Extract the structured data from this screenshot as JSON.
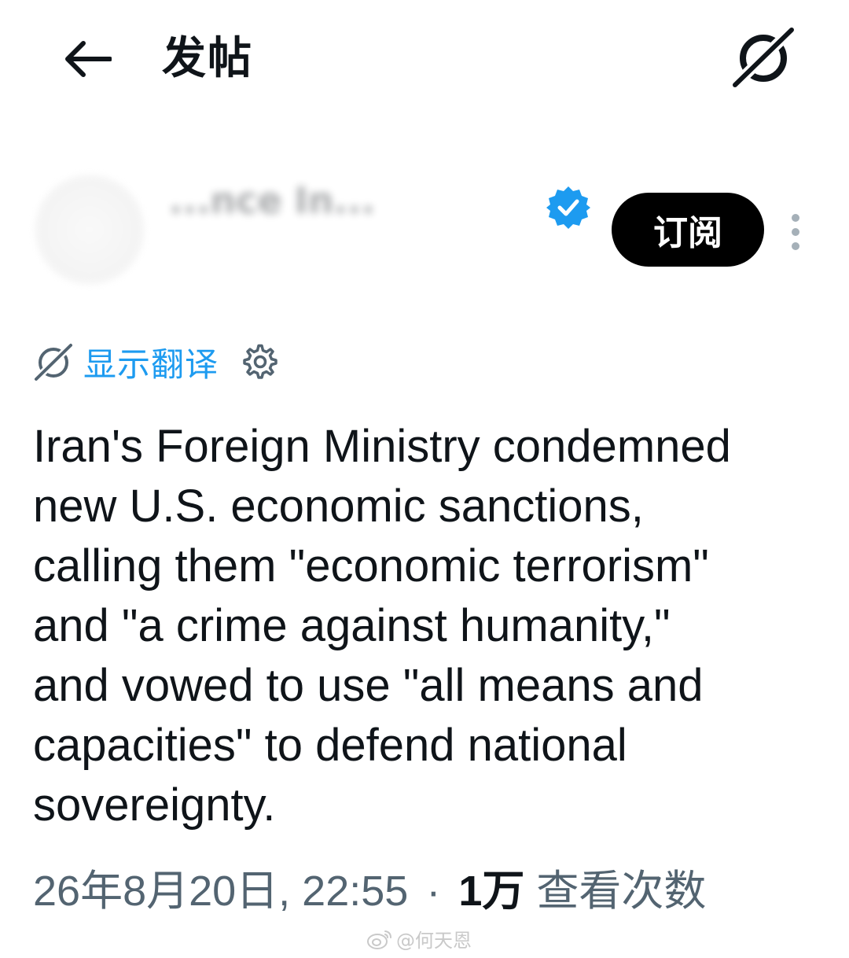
{
  "header": {
    "back_icon": "arrow-left-icon",
    "title": "发帖",
    "translate_icon": "translate-icon"
  },
  "author": {
    "display_name": "...nce In...",
    "verified_icon": "verified-badge-icon",
    "verified_color": "#1d9bf0",
    "subscribe_label": "订阅",
    "more_icon": "more-vertical-icon"
  },
  "translation": {
    "icon": "translate-icon",
    "label": "显示翻译",
    "settings_icon": "gear-icon",
    "link_color": "#1d9bf0"
  },
  "tweet": {
    "lines": [
      "Iran's Foreign Ministry condemned",
      "new U.S. economic sanctions,",
      "calling them \"economic terrorism\"",
      "and \"a crime against humanity,\"",
      "and vowed to use \"all means and",
      "capacities\" to defend national",
      "sovereignty."
    ]
  },
  "meta": {
    "timestamp": "26年8月20日, 22:55",
    "separator": "·",
    "views_count": "1万",
    "views_label": "查看次数"
  },
  "watermark": {
    "icon": "weibo-icon",
    "text": "@何天恩"
  }
}
